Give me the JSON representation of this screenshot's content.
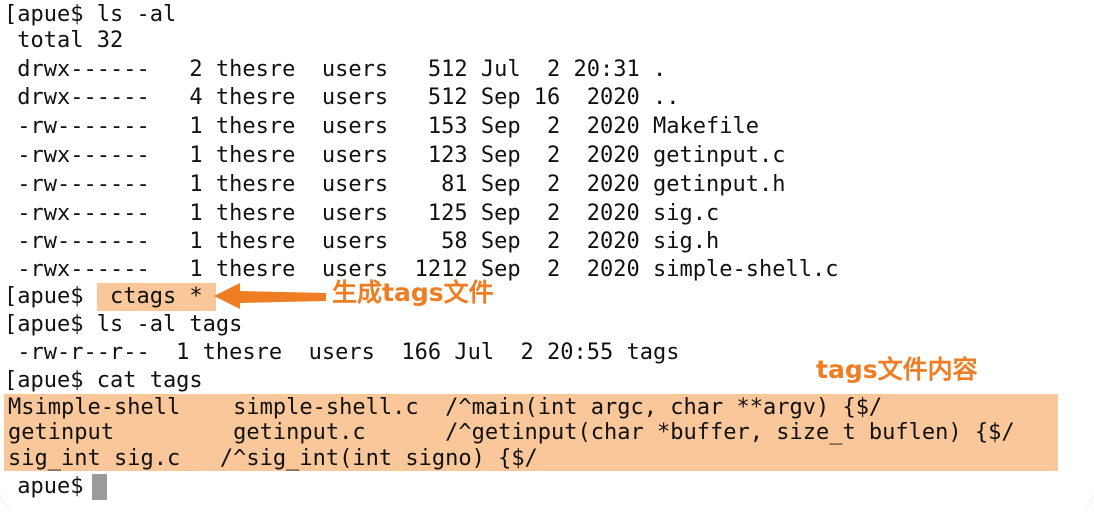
{
  "terminal": {
    "background_color": "#ffffff",
    "text_color": "#111111",
    "highlight_color": "#f9c79a",
    "accent_color": "#ee7d23",
    "cursor_color": "#9b9b9b",
    "lines": [
      {
        "id": "l1",
        "text": "[apue$ ls -al"
      },
      {
        "id": "l2",
        "text": " total 32"
      },
      {
        "id": "l3",
        "text": " drwx------   2 thesre  users   512 Jul  2 20:31 ."
      },
      {
        "id": "l4",
        "text": " drwx------   4 thesre  users   512 Sep 16  2020 .."
      },
      {
        "id": "l5",
        "text": " -rw-------   1 thesre  users   153 Sep  2  2020 Makefile"
      },
      {
        "id": "l6",
        "text": " -rwx------   1 thesre  users   123 Sep  2  2020 getinput.c"
      },
      {
        "id": "l7",
        "text": " -rw-------   1 thesre  users    81 Sep  2  2020 getinput.h"
      },
      {
        "id": "l8",
        "text": " -rwx------   1 thesre  users   125 Sep  2  2020 sig.c"
      },
      {
        "id": "l9",
        "text": " -rw-------   1 thesre  users    58 Sep  2  2020 sig.h"
      },
      {
        "id": "l10",
        "text": " -rwx------   1 thesre  users  1212 Sep  2  2020 simple-shell.c"
      }
    ],
    "ctags_line": {
      "prompt": "[apue$ ",
      "command": " ctags * "
    },
    "lines2": [
      {
        "id": "l12",
        "text": "[apue$ ls -al tags"
      },
      {
        "id": "l13",
        "text": " -rw-r--r--  1 thesre  users  166 Jul  2 20:55 tags"
      },
      {
        "id": "l14",
        "text": "[apue$ cat tags"
      }
    ],
    "tags_content": [
      {
        "id": "t1",
        "text": "Msimple-shell    simple-shell.c  /^main(int argc, char **argv) {$/"
      },
      {
        "id": "t2",
        "text": "getinput         getinput.c      /^getinput(char *buffer, size_t buflen) {$/"
      },
      {
        "id": "t3",
        "text": "sig_int sig.c   /^sig_int(int signo) {$/"
      }
    ],
    "final_prompt": " apue$ "
  },
  "annotations": {
    "generate_tags": "生成tags文件",
    "tags_file_content": "tags文件内容"
  },
  "icons": {
    "arrow": "left-arrow-icon",
    "cursor": "text-cursor"
  }
}
